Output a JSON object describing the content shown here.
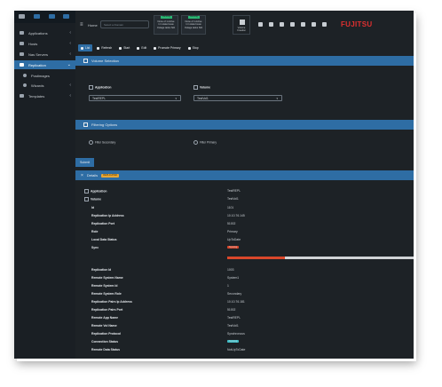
{
  "sidebar": {
    "items": [
      {
        "label": "Applications",
        "chevron": "‹"
      },
      {
        "label": "Hosts",
        "chevron": "‹"
      },
      {
        "label": "Nas Servers",
        "chevron": "‹"
      },
      {
        "label": "Replication",
        "chevron": "⌄"
      },
      {
        "label": "Postimages",
        "chevron": ""
      },
      {
        "label": "Wizards",
        "chevron": "‹"
      },
      {
        "label": "Templates",
        "chevron": "‹"
      }
    ]
  },
  "topbar": {
    "home_label": "Home",
    "select_placeholder": "Select a Domain",
    "cards": [
      {
        "badge": "Running",
        "line1": "None of 1 Active",
        "line2": "1 in state Issue",
        "line3": "Outage tasks N/A"
      },
      {
        "badge": "Running",
        "line1": "None of 1 Active",
        "line2": "1 in state Issue",
        "line3": "Outage tasks N/A"
      }
    ],
    "volume_label": "Volume Creation",
    "logo": "FUJITSU"
  },
  "actions": [
    {
      "label": "List",
      "icon": "list-icon"
    },
    {
      "label": "Refresh",
      "icon": "refresh-icon"
    },
    {
      "label": "Start",
      "icon": "play-icon"
    },
    {
      "label": "Edit",
      "icon": "edit-icon"
    },
    {
      "label": "Promote Primary",
      "icon": "promote-icon"
    },
    {
      "label": "Stop",
      "icon": "stop-icon"
    }
  ],
  "volume_selection": {
    "title": "Volume Selection",
    "application_label": "Application",
    "application_value": "TestREPL",
    "volume_label": "Volume",
    "volume_value": "TestVol1"
  },
  "filtering": {
    "title": "Filtering Options",
    "option1": "Filter Secondary",
    "option2": "Filter Primary"
  },
  "tabs": [
    {
      "label": "Submit"
    }
  ],
  "details": {
    "title": "Details",
    "tag": "REPLICATED",
    "rows_top": [
      {
        "key": "Application",
        "value": "TestREPL"
      },
      {
        "key": "Volume",
        "value": "TestVol1"
      },
      {
        "key": "Id",
        "value": "1101"
      },
      {
        "key": "Replication Ip Address",
        "value": "10.10.76.145"
      },
      {
        "key": "Replication Port",
        "value": "51002"
      },
      {
        "key": "Role",
        "value": "Primary"
      },
      {
        "key": "Local Data Status",
        "value": "UpToDate"
      },
      {
        "key": "Sync",
        "value": "Syncing"
      }
    ],
    "sync_progress": 0.31,
    "rows_bottom": [
      {
        "key": "Replication Id",
        "value": "1003"
      },
      {
        "key": "Remote System Name",
        "value": "System1"
      },
      {
        "key": "Remote System Id",
        "value": "1"
      },
      {
        "key": "Remote System Role",
        "value": "Secondary"
      },
      {
        "key": "Replication Pairs Ip Address",
        "value": "10.10.76.181"
      },
      {
        "key": "Replication Pairs Port",
        "value": "51002"
      },
      {
        "key": "Remote App Name",
        "value": "TestREPL"
      },
      {
        "key": "Remote Vol Name",
        "value": "TestVol1"
      },
      {
        "key": "Replication Protocol",
        "value": "Synchronous"
      },
      {
        "key": "Connection Status",
        "value": "Syncing"
      },
      {
        "key": "Remote Data Status",
        "value": "NotUpToDate"
      }
    ]
  },
  "colors": {
    "accent": "#2e6da4",
    "sync": "#d9472b",
    "connection": "#3fbfc8",
    "logo": "#e03030"
  }
}
